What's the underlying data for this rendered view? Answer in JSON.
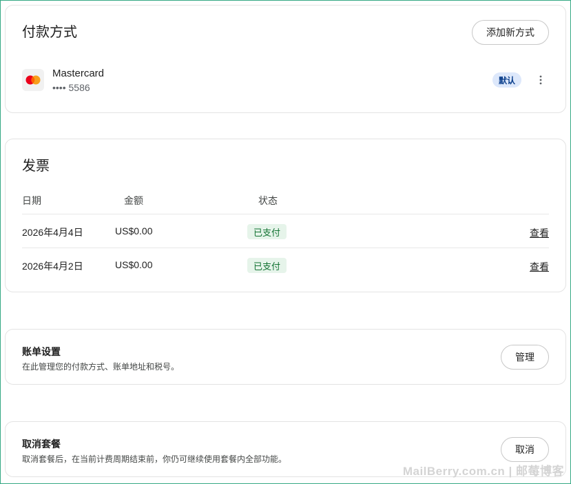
{
  "payment": {
    "title": "付款方式",
    "add_button": "添加新方式",
    "method": {
      "brand": "Mastercard",
      "number": "•••• 5586",
      "badge": "默认",
      "icon": "mastercard-icon"
    }
  },
  "invoices": {
    "title": "发票",
    "headers": {
      "date": "日期",
      "amount": "金额",
      "status": "状态"
    },
    "rows": [
      {
        "date": "2026年4月4日",
        "amount": "US$0.00",
        "status": "已支付",
        "action": "查看"
      },
      {
        "date": "2026年4月2日",
        "amount": "US$0.00",
        "status": "已支付",
        "action": "查看"
      }
    ]
  },
  "billing_settings": {
    "title": "账单设置",
    "description": "在此管理您的付款方式、账单地址和税号。",
    "button": "管理"
  },
  "cancel_plan": {
    "title": "取消套餐",
    "description": "取消套餐后，在当前计费周期结束前，你仍可继续使用套餐内全部功能。",
    "button": "取消"
  },
  "watermark": "MailBerry.com.cn | 邮莓博客",
  "colors": {
    "status_paid_bg": "#e6f4ea",
    "status_paid_text": "#137333",
    "default_badge_bg": "#dde8fb",
    "default_badge_text": "#0b3f8c",
    "mastercard_red": "#eb001b",
    "mastercard_orange": "#f79e1b"
  }
}
